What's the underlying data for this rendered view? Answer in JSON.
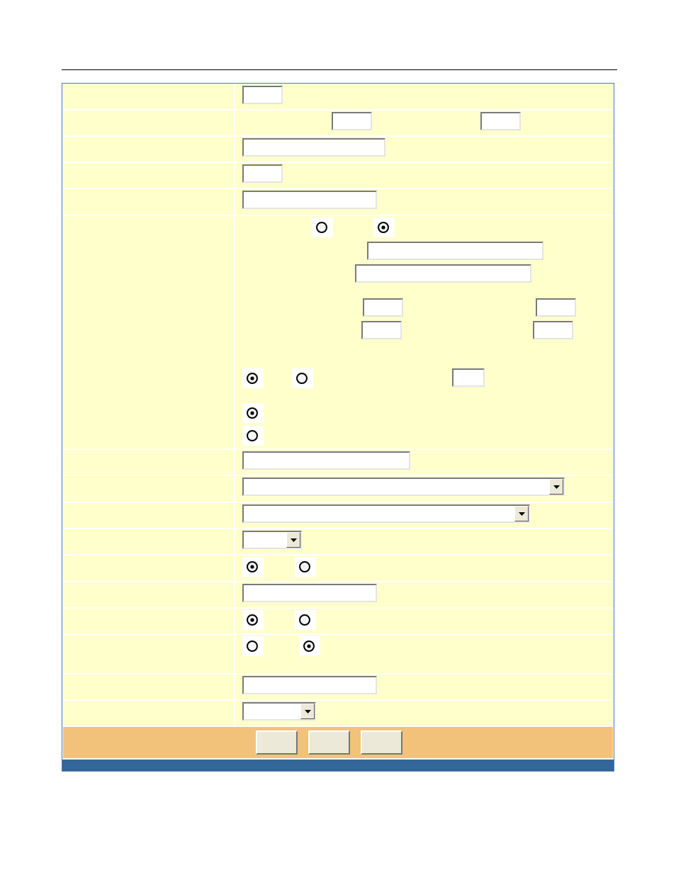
{
  "form": {
    "rows": [
      {
        "lines": [
          {
            "controls": [
              {
                "kind": "field"
              }
            ]
          }
        ]
      },
      {
        "lines": [
          {
            "controls": [
              {
                "kind": "field"
              },
              {
                "kind": "field"
              }
            ]
          }
        ]
      },
      {
        "lines": [
          {
            "controls": [
              {
                "kind": "field"
              }
            ]
          }
        ]
      },
      {
        "lines": [
          {
            "controls": [
              {
                "kind": "field"
              }
            ]
          }
        ]
      },
      {
        "lines": [
          {
            "controls": [
              {
                "kind": "field"
              }
            ]
          }
        ]
      },
      {
        "lines": [
          {
            "controls": [
              {
                "kind": "radio",
                "selected": false
              },
              {
                "kind": "radio",
                "selected": true
              }
            ]
          },
          {
            "controls": [
              {
                "kind": "field"
              }
            ]
          },
          {
            "controls": [
              {
                "kind": "field"
              }
            ]
          },
          {
            "controls": [
              {
                "kind": "field"
              },
              {
                "kind": "field"
              }
            ]
          },
          {
            "controls": [
              {
                "kind": "field"
              },
              {
                "kind": "field"
              }
            ]
          },
          {
            "controls": [
              {
                "kind": "radio",
                "selected": true
              },
              {
                "kind": "radio",
                "selected": false
              },
              {
                "kind": "field"
              }
            ]
          },
          {
            "controls": [
              {
                "kind": "radio",
                "selected": true
              }
            ]
          },
          {
            "controls": [
              {
                "kind": "radio",
                "selected": false
              }
            ]
          }
        ]
      },
      {
        "lines": [
          {
            "controls": [
              {
                "kind": "field"
              }
            ]
          }
        ]
      },
      {
        "lines": [
          {
            "controls": [
              {
                "kind": "select"
              }
            ]
          }
        ]
      },
      {
        "lines": [
          {
            "controls": [
              {
                "kind": "select"
              }
            ]
          }
        ]
      },
      {
        "lines": [
          {
            "controls": [
              {
                "kind": "select"
              }
            ]
          }
        ]
      },
      {
        "lines": [
          {
            "controls": [
              {
                "kind": "radio",
                "selected": true
              },
              {
                "kind": "radio",
                "selected": false
              }
            ]
          }
        ]
      },
      {
        "lines": [
          {
            "controls": [
              {
                "kind": "field"
              }
            ]
          }
        ]
      },
      {
        "lines": [
          {
            "controls": [
              {
                "kind": "radio",
                "selected": true
              },
              {
                "kind": "radio",
                "selected": false
              }
            ]
          }
        ]
      },
      {
        "lines": [
          {
            "controls": [
              {
                "kind": "radio",
                "selected": false
              },
              {
                "kind": "radio",
                "selected": true
              }
            ]
          }
        ]
      },
      {
        "lines": [
          {
            "controls": [
              {
                "kind": "field"
              }
            ]
          }
        ]
      },
      {
        "lines": [
          {
            "controls": [
              {
                "kind": "select"
              }
            ]
          }
        ]
      }
    ]
  },
  "buttons": [
    {
      "kind": "button"
    },
    {
      "kind": "button"
    },
    {
      "kind": "button"
    }
  ]
}
